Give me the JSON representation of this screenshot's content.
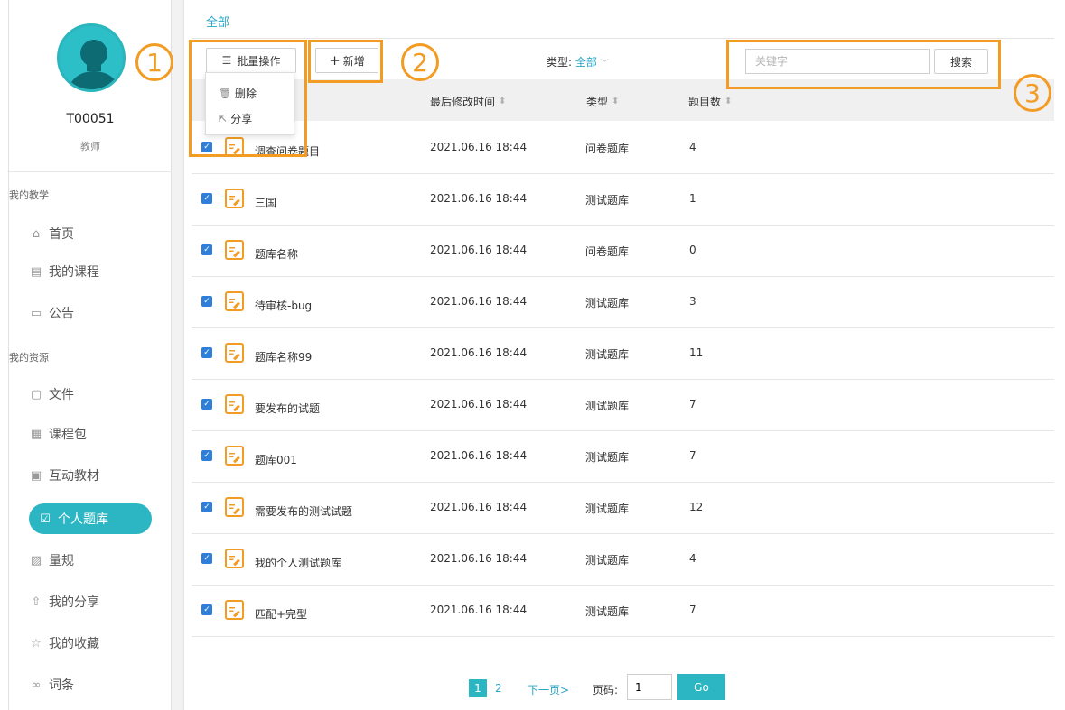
{
  "user": {
    "id": "T00051",
    "role": "教师"
  },
  "sidebar": {
    "section1": "我的教学",
    "section2": "我的资源",
    "items": [
      {
        "label": "首页",
        "icon": "home-icon"
      },
      {
        "label": "我的课程",
        "icon": "book-icon"
      },
      {
        "label": "公告",
        "icon": "notice-icon"
      },
      {
        "label": "文件",
        "icon": "file-icon"
      },
      {
        "label": "课程包",
        "icon": "package-icon"
      },
      {
        "label": "互动教材",
        "icon": "interactive-icon"
      },
      {
        "label": "个人题库",
        "icon": "question-bank-icon",
        "active": true
      },
      {
        "label": "量规",
        "icon": "rubric-icon"
      },
      {
        "label": "我的分享",
        "icon": "share-icon"
      },
      {
        "label": "我的收藏",
        "icon": "star-icon"
      },
      {
        "label": "词条",
        "icon": "link-icon"
      }
    ]
  },
  "breadcrumb": "全部",
  "toolbar": {
    "batch_label": "批量操作",
    "add_label": "新增",
    "type_label": "类型:",
    "type_value": "全部",
    "search_placeholder": "关键字",
    "search_button": "搜索"
  },
  "dropdown": {
    "delete": "删除",
    "share": "分享"
  },
  "annotations": [
    "1",
    "2",
    "3"
  ],
  "table": {
    "headers": [
      "最后修改时间",
      "类型",
      "题目数"
    ],
    "rows": [
      {
        "name": "调查问卷题目",
        "time": "2021.06.16 18:44",
        "type": "问卷题库",
        "count": "4"
      },
      {
        "name": "三国",
        "time": "2021.06.16 18:44",
        "type": "测试题库",
        "count": "1"
      },
      {
        "name": "题库名称",
        "time": "2021.06.16 18:44",
        "type": "问卷题库",
        "count": "0"
      },
      {
        "name": "待审核-bug",
        "time": "2021.06.16 18:44",
        "type": "测试题库",
        "count": "3"
      },
      {
        "name": "题库名称99",
        "time": "2021.06.16 18:44",
        "type": "测试题库",
        "count": "11"
      },
      {
        "name": "要发布的试题",
        "time": "2021.06.16 18:44",
        "type": "测试题库",
        "count": "7"
      },
      {
        "name": "题库001",
        "time": "2021.06.16 18:44",
        "type": "测试题库",
        "count": "7"
      },
      {
        "name": "需要发布的测试试题",
        "time": "2021.06.16 18:44",
        "type": "测试题库",
        "count": "12"
      },
      {
        "name": "我的个人测试题库",
        "time": "2021.06.16 18:44",
        "type": "测试题库",
        "count": "4"
      },
      {
        "name": "匹配+完型",
        "time": "2021.06.16 18:44",
        "type": "测试题库",
        "count": "7"
      }
    ]
  },
  "pager": {
    "current": "1",
    "page2": "2",
    "next": "下一页>",
    "label": "页码:",
    "input_value": "1",
    "go": "Go"
  },
  "colors": {
    "accent": "#2cb5c2",
    "highlight": "#f29c24",
    "link": "#2aa6c7"
  }
}
